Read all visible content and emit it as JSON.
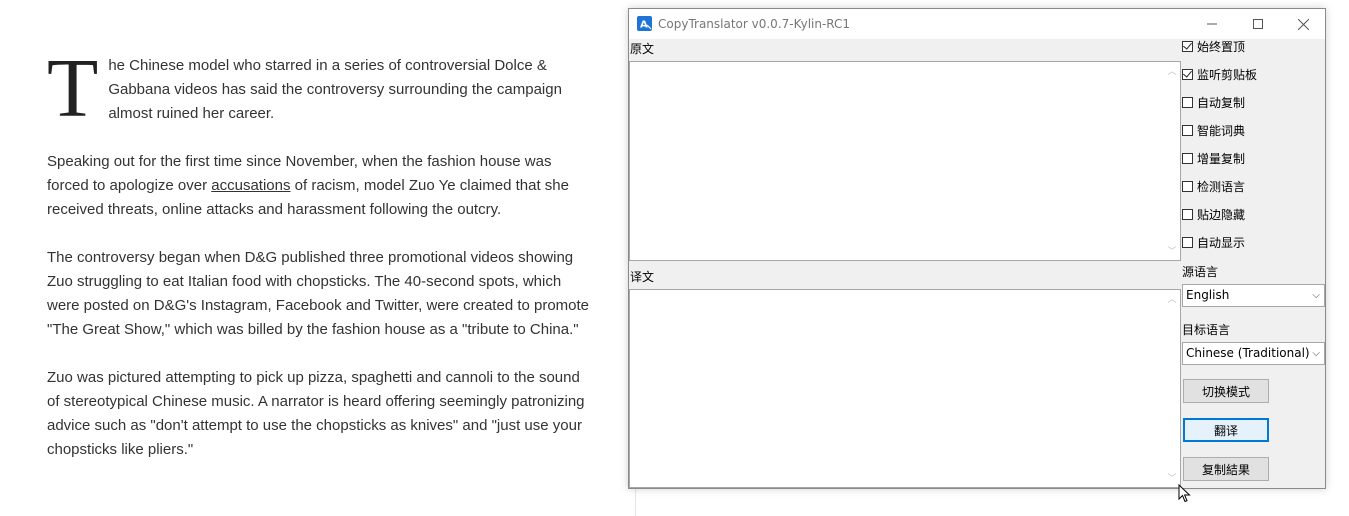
{
  "article": {
    "dropcap": "T",
    "p1": "he Chinese model who starred in a series of controversial Dolce & Gabbana videos has said the controversy surrounding the campaign almost ruined her career.",
    "p2_before": "Speaking out for the first time since November, when the fashion house was forced to apologize over ",
    "p2_link": "accusations",
    "p2_after": " of racism, model Zuo Ye claimed that she received threats, online attacks and harassment following the outcry.",
    "p3": "The controversy began when D&G published three promotional videos showing Zuo struggling to eat Italian food with chopsticks. The 40-second spots, which were posted on D&G's Instagram, Facebook and Twitter, were created to promote \"The Great Show,\" which was billed by the fashion house as a \"tribute to China.\"",
    "p4": "Zuo was pictured attempting to pick up pizza, spaghetti and cannoli to the sound of stereotypical Chinese music. A narrator is heard offering seemingly patronizing advice such as \"don't attempt to use the chopsticks as knives\" and \"just use your chopsticks like pliers.\""
  },
  "window": {
    "title": "CopyTranslator v0.0.7-Kylin-RC1",
    "icon": "translate-app-icon",
    "controls": {
      "minimize": "minimize-icon",
      "maximize": "maximize-icon",
      "close": "close-icon"
    },
    "source_label": "原文",
    "target_label": "译文",
    "source_text": "",
    "target_text": "",
    "options": [
      {
        "label": "始终置顶",
        "checked": true
      },
      {
        "label": "监听剪贴板",
        "checked": true
      },
      {
        "label": "自动复制",
        "checked": false
      },
      {
        "label": "智能词典",
        "checked": false
      },
      {
        "label": "增量复制",
        "checked": false
      },
      {
        "label": "检测语言",
        "checked": false
      },
      {
        "label": "贴边隐藏",
        "checked": false
      },
      {
        "label": "自动显示",
        "checked": false
      }
    ],
    "source_lang_label": "源语言",
    "source_lang": "English",
    "target_lang_label": "目标语言",
    "target_lang": "Chinese (Traditional)",
    "btn_switch": "切换模式",
    "btn_translate": "翻译",
    "btn_copy": "复制結果"
  },
  "colors": {
    "accent": "#0078d7",
    "window_bg": "#f0f0f0",
    "text": "#333333"
  }
}
